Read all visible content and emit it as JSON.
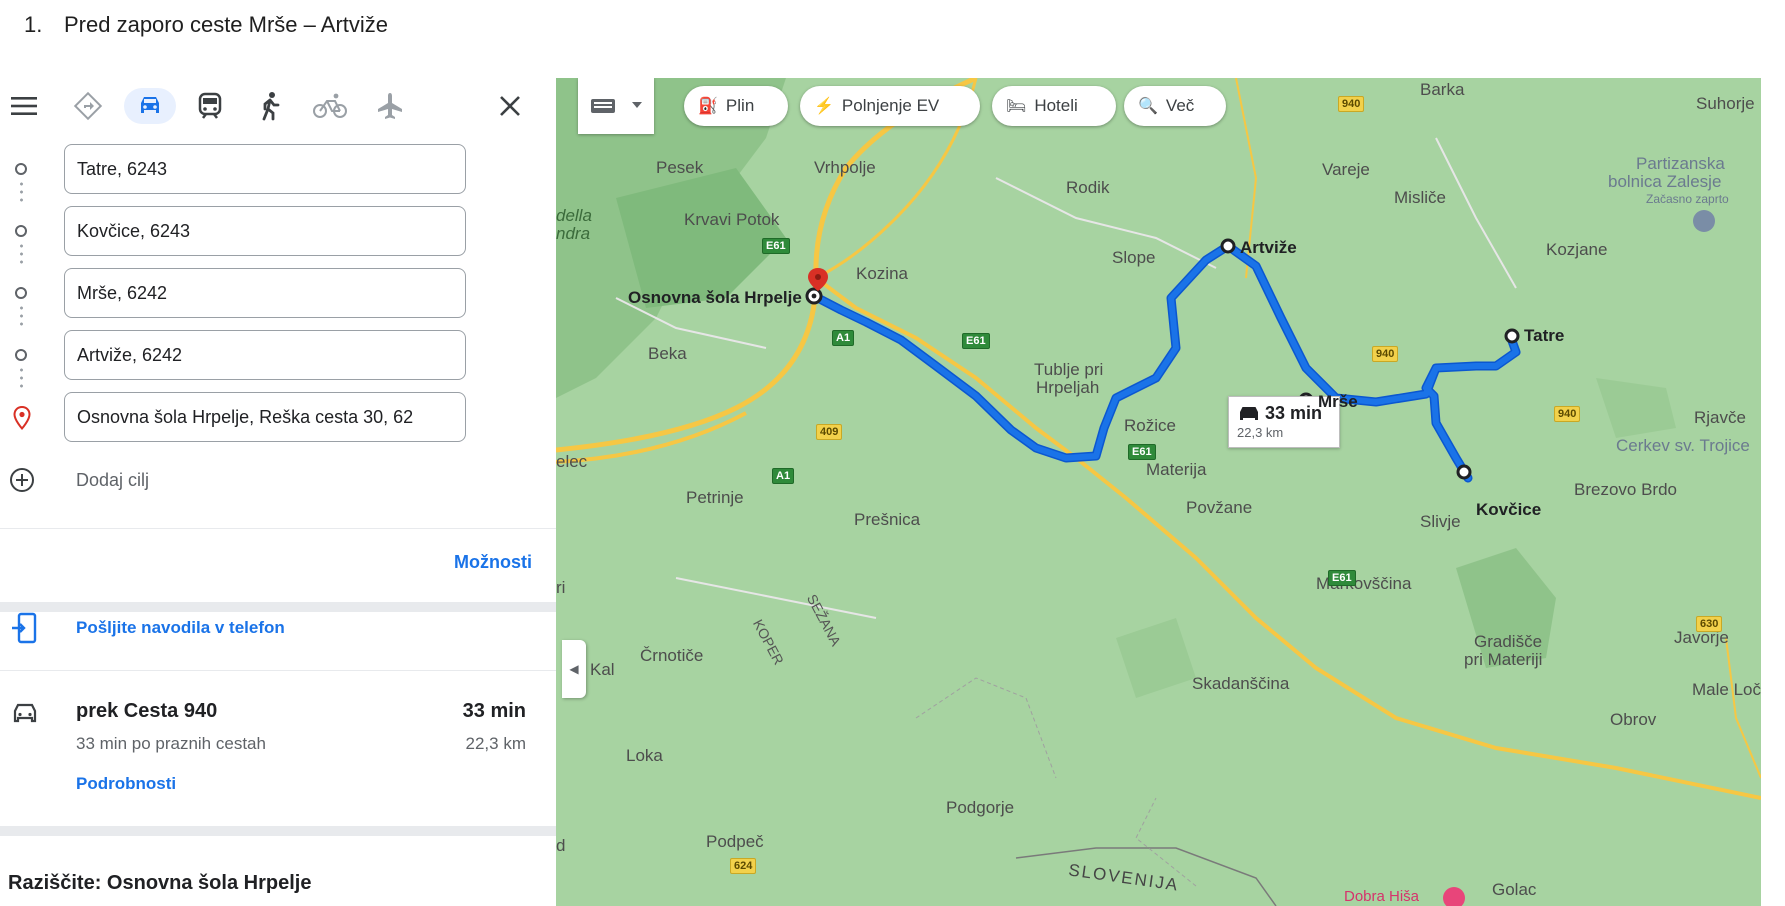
{
  "heading": {
    "number": "1.",
    "text": "Pred zaporo ceste Mrše – Artviže"
  },
  "sidebar": {
    "modes": [
      {
        "name": "menu-icon"
      },
      {
        "name": "directions-icon"
      },
      {
        "name": "car-icon",
        "active": true
      },
      {
        "name": "transit-icon"
      },
      {
        "name": "walk-icon"
      },
      {
        "name": "bike-icon"
      },
      {
        "name": "flight-icon"
      },
      {
        "name": "close-icon"
      }
    ],
    "stops": [
      {
        "value": "Tatre, 6243"
      },
      {
        "value": "Kovčice, 6243"
      },
      {
        "value": "Mrše, 6242"
      },
      {
        "value": "Artviže, 6242"
      },
      {
        "value": "Osnovna šola Hrpelje, Reška cesta 30, 62"
      }
    ],
    "add_destination": "Dodaj cilj",
    "options": "Možnosti",
    "send_to_phone": "Pošljite navodila v telefon",
    "route": {
      "title": "prek Cesta 940",
      "subtitle": "33 min po praznih cestah",
      "time": "33 min",
      "distance": "22,3 km",
      "details": "Podrobnosti"
    },
    "explore": "Raziščite: Osnovna šola Hrpelje"
  },
  "map": {
    "chips": [
      {
        "icon": "fuel-icon",
        "label": "Plin"
      },
      {
        "icon": "ev-charging-icon",
        "label": "Polnjenje EV"
      },
      {
        "icon": "hotel-icon",
        "label": "Hoteli"
      },
      {
        "icon": "search-icon",
        "label": "Več"
      }
    ],
    "callout": {
      "time": "33 min",
      "distance": "22,3 km"
    },
    "places": {
      "barka": "Barka",
      "suhorje": "Suhorje",
      "pesek": "Pesek",
      "vrhpolje": "Vrhpolje",
      "rodik": "Rodik",
      "vareje": "Vareje",
      "mislice": "Misliče",
      "partizanska": "Partizanska",
      "bolnica": "bolnica Zalesje",
      "zacasno": "Začasno zaprto",
      "della": "della",
      "ndra": "ndra",
      "krvavi": "Krvavi Potok",
      "kozjane": "Kozjane",
      "slope": "Slope",
      "artvize": "Artviže",
      "kozina": "Kozina",
      "osnovna": "Osnovna šola Hrpelje",
      "beka": "Beka",
      "tublje1": "Tublje pri",
      "tublje2": "Hrpeljah",
      "tatre": "Tatre",
      "rjavce": "Rjavče",
      "cerkev": "Cerkev sv. Trojice",
      "rozice": "Rožice",
      "mrse": "Mrše",
      "elec": "elec",
      "materija": "Materija",
      "brezovo": "Brezovo Brdo",
      "kovcice": "Kovčice",
      "petrinje": "Petrinje",
      "povzane": "Povžane",
      "presnica": "Prešnica",
      "slivje": "Slivje",
      "ri": "ri",
      "markovscina": "Markovščina",
      "sezana": "SEŽANA",
      "koper": "KOPER",
      "crnotice": "Črnotiče",
      "kal": "Kal",
      "gradisce1": "Gradišče",
      "gradisce2": "pri Materiji",
      "javorje": "Javorje",
      "skadanscina": "Skadanščina",
      "maleloc": "Male Loč",
      "obrov": "Obrov",
      "loka": "Loka",
      "podgorje": "Podgorje",
      "d": "d",
      "podpec": "Podpeč",
      "slovenija": "SLOVENIJA",
      "golac": "Golac",
      "dobrahisa": "Dobra Hiša"
    },
    "shields": {
      "r940a": "940",
      "r940b": "940",
      "r940c": "940",
      "r409": "409",
      "r624": "624",
      "r630": "630",
      "e61a": "E61",
      "e61b": "E61",
      "e61c": "E61",
      "e61d": "E61",
      "a1a": "A1",
      "a1b": "A1"
    },
    "colors": {
      "route": "#1a73e8",
      "route_outline": "#0b57d0",
      "land": "#a7d3a1",
      "highway": "#f6c744",
      "pin": "#d93025"
    }
  }
}
